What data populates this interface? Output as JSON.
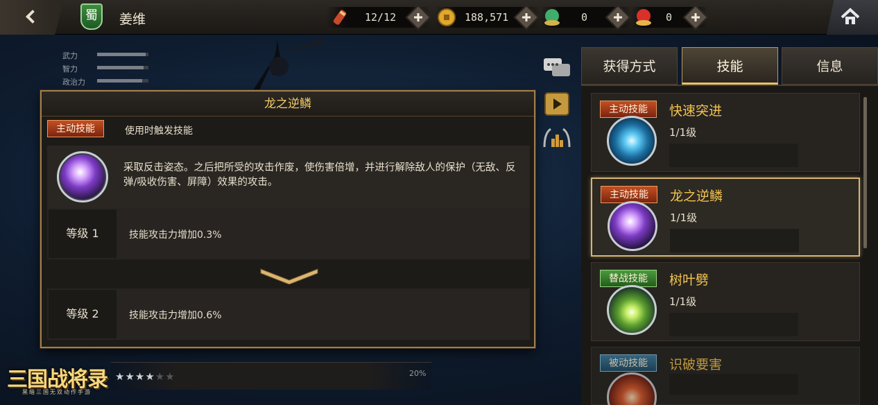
{
  "header": {
    "hero_name": "姜维",
    "faction": "蜀",
    "resources": [
      {
        "name": "stamina",
        "value": "12/12",
        "icon": "scroll-icon"
      },
      {
        "name": "gold",
        "value": "188,571",
        "icon": "coin-icon"
      },
      {
        "name": "jade",
        "value": "0",
        "icon": "jade-icon"
      },
      {
        "name": "ruby",
        "value": "0",
        "icon": "ruby-icon"
      }
    ]
  },
  "stats": [
    {
      "label": "武力"
    },
    {
      "label": "智力"
    },
    {
      "label": "政治力"
    }
  ],
  "popup": {
    "title": "龙之逆鳞",
    "type_label": "主动技能",
    "subtitle": "使用时触发技能",
    "description": "采取反击姿态。之后把所受的攻击作废，使伤害倍增，并进行解除敌人的保护（无敌、反弹/吸收伤害、屏障）效果的攻击。",
    "levels": [
      {
        "label": "等级 1",
        "text": "技能攻击力增加0.3%"
      },
      {
        "label": "等级 2",
        "text": "技能攻击力增加0.6%"
      }
    ]
  },
  "tabs": [
    {
      "label": "获得方式",
      "active": false
    },
    {
      "label": "技能",
      "active": true
    },
    {
      "label": "信息",
      "active": false
    }
  ],
  "skills": [
    {
      "type": "主动技能",
      "name": "快速突进",
      "level": "1/1级",
      "orb": "blue"
    },
    {
      "type": "主动技能",
      "name": "龙之逆鳞",
      "level": "1/1级",
      "orb": "purple",
      "selected": true
    },
    {
      "type": "替战技能",
      "name": "树叶劈",
      "level": "1/1级",
      "orb": "green"
    },
    {
      "type": "被动技能",
      "name": "识破要害",
      "level": "",
      "orb": "red"
    }
  ],
  "bottom": {
    "percent": "20%"
  },
  "logo": {
    "title": "三国战将录",
    "subtitle": "黑暗三国无双动作手游"
  },
  "colors": {
    "accent_gold": "#f3c34e",
    "active_badge": "#c44f22",
    "swap_badge": "#4b9a3c",
    "passive_badge": "#3d7fa4",
    "popup_border": "#a27f4c"
  }
}
